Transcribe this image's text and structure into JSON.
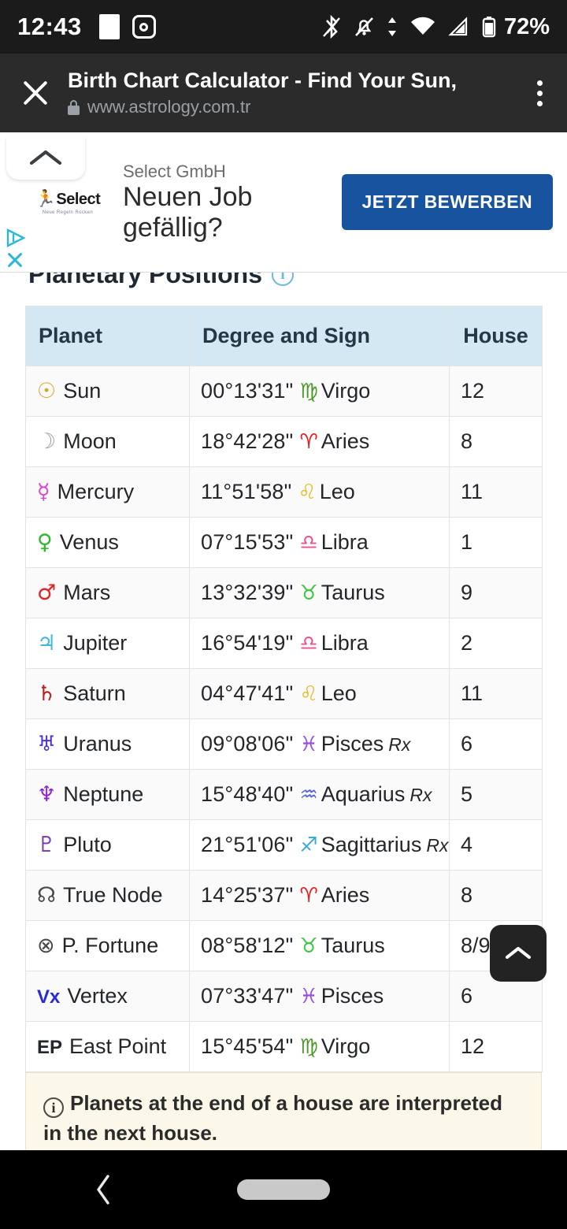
{
  "status_bar": {
    "time": "12:43",
    "battery_percent": "72%",
    "wifi_level": "4",
    "icons": [
      "screenshot-icon",
      "instagram-icon",
      "bluetooth-icon",
      "notifications-muted-icon",
      "mobile-data-icon",
      "wifi-icon",
      "cellular-signal-icon",
      "battery-icon"
    ]
  },
  "browser": {
    "title": "Birth Chart Calculator - Find Your Sun,",
    "url": "www.astrology.com.tr",
    "close_label": "close-icon",
    "menu_label": "overflow-menu-icon"
  },
  "ad": {
    "advertiser": "Select GmbH",
    "headline": "Neuen Job gefällig?",
    "cta_label": "JETZT BEWERBEN",
    "logo_text": "Select",
    "logo_tagline": "Neue Regeln Rocken",
    "adchoices_label": "adchoices-icon",
    "close_label": "ad-close-icon",
    "accent_color": "#17539e",
    "adchoices_color": "#2ab8d4"
  },
  "section": {
    "title": "Planetary Positions",
    "info_glyph": "i",
    "collapse_label": "collapse-section-button"
  },
  "table": {
    "headers": [
      "Planet",
      "Degree and Sign",
      "House"
    ],
    "rows": [
      {
        "glyph": "☉",
        "glyph_color": "#d8a51e",
        "planet": "Sun",
        "degree": "00°13'31\"",
        "sign_glyph": "♍",
        "sign_color": "#4c9a2a",
        "sign": "Virgo",
        "rx": "",
        "house": "12"
      },
      {
        "glyph": "☽",
        "glyph_color": "#9e9e9e",
        "planet": "Moon",
        "degree": "18°42'28\"",
        "sign_glyph": "♈",
        "sign_color": "#e02020",
        "sign": "Aries",
        "rx": "",
        "house": "8"
      },
      {
        "glyph": "☿",
        "glyph_color": "#e040d0",
        "planet": "Mercury",
        "degree": "11°51'58\"",
        "sign_glyph": "♌",
        "sign_color": "#e8b923",
        "sign": "Leo",
        "rx": "",
        "house": "11"
      },
      {
        "glyph": "♀",
        "glyph_color": "#2eb82e",
        "planet": "Venus",
        "degree": "07°15'53\"",
        "sign_glyph": "♎",
        "sign_color": "#ef4f8f",
        "sign": "Libra",
        "rx": "",
        "house": "1"
      },
      {
        "glyph": "♂",
        "glyph_color": "#e02424",
        "planet": "Mars",
        "degree": "13°32'39\"",
        "sign_glyph": "♉",
        "sign_color": "#3cc43c",
        "sign": "Taurus",
        "rx": "",
        "house": "9"
      },
      {
        "glyph": "♃",
        "glyph_color": "#3fb9d4",
        "planet": "Jupiter",
        "degree": "16°54'19\"",
        "sign_glyph": "♎",
        "sign_color": "#ef4f8f",
        "sign": "Libra",
        "rx": "",
        "house": "2"
      },
      {
        "glyph": "♄",
        "glyph_color": "#b52020",
        "planet": "Saturn",
        "degree": "04°47'41\"",
        "sign_glyph": "♌",
        "sign_color": "#e8b923",
        "sign": "Leo",
        "rx": "",
        "house": "11"
      },
      {
        "glyph": "♅",
        "glyph_color": "#4834d4",
        "planet": "Uranus",
        "degree": "09°08'06\"",
        "sign_glyph": "♓",
        "sign_color": "#9b4bd6",
        "sign": "Pisces",
        "rx": "Rx",
        "house": "6"
      },
      {
        "glyph": "♆",
        "glyph_color": "#8e24c9",
        "planet": "Neptune",
        "degree": "15°48'40\"",
        "sign_glyph": "♒",
        "sign_color": "#5566d8",
        "sign": "Aquarius",
        "rx": "Rx",
        "house": "5"
      },
      {
        "glyph": "♇",
        "glyph_color": "#7b2fbe",
        "planet": "Pluto",
        "degree": "21°51'06\"",
        "sign_glyph": "♐",
        "sign_color": "#3aa8d8",
        "sign": "Sagittarius",
        "rx": "Rx",
        "house": "4"
      },
      {
        "glyph": "☊",
        "glyph_color": "#4a4a4a",
        "planet": "True Node",
        "degree": "14°25'37\"",
        "sign_glyph": "♈",
        "sign_color": "#e02020",
        "sign": "Aries",
        "rx": "",
        "house": "8"
      },
      {
        "glyph": "⊗",
        "glyph_color": "#4a4a4a",
        "planet": "P. Fortune",
        "degree": "08°58'12\"",
        "sign_glyph": "♉",
        "sign_color": "#3cc43c",
        "sign": "Taurus",
        "rx": "",
        "house": "8/9"
      },
      {
        "glyph": "Vx",
        "glyph_color": "#2b2bd6",
        "planet": "Vertex",
        "degree": "07°33'47\"",
        "sign_glyph": "♓",
        "sign_color": "#9b4bd6",
        "sign": "Pisces",
        "rx": "",
        "house": "6"
      },
      {
        "glyph": "EP",
        "glyph_color": "#23272b",
        "planet": "East Point",
        "degree": "15°45'54\"",
        "sign_glyph": "♍",
        "sign_color": "#4c9a2a",
        "sign": "Virgo",
        "rx": "",
        "house": "12"
      }
    ]
  },
  "note": {
    "icon": "info-icon",
    "text": "Planets at the end of a house are interpreted in the next house."
  },
  "scroll_top_button": {
    "label": "scroll-to-top-button"
  },
  "nav_bar": {
    "back_label": "back-button",
    "home_label": "home-pill"
  }
}
